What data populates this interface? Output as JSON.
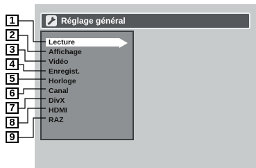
{
  "header": {
    "title": "Réglage général",
    "icon": "wrench-icon"
  },
  "menu": {
    "items": [
      {
        "label": "Lecture",
        "number": "1",
        "selected": true
      },
      {
        "label": "Affichage",
        "number": "2"
      },
      {
        "label": "Vidéo",
        "number": "3"
      },
      {
        "label": "Enregist.",
        "number": "4"
      },
      {
        "label": "Horloge",
        "number": "5"
      },
      {
        "label": "Canal",
        "number": "6"
      },
      {
        "label": "DivX",
        "number": "7"
      },
      {
        "label": "HDMI",
        "number": "8"
      },
      {
        "label": "RAZ",
        "number": "9"
      }
    ]
  },
  "colors": {
    "screen": "#c8cbcc",
    "title_bar": "#55585b",
    "menu_panel": "#8e9193",
    "highlight": "#ffffff"
  }
}
